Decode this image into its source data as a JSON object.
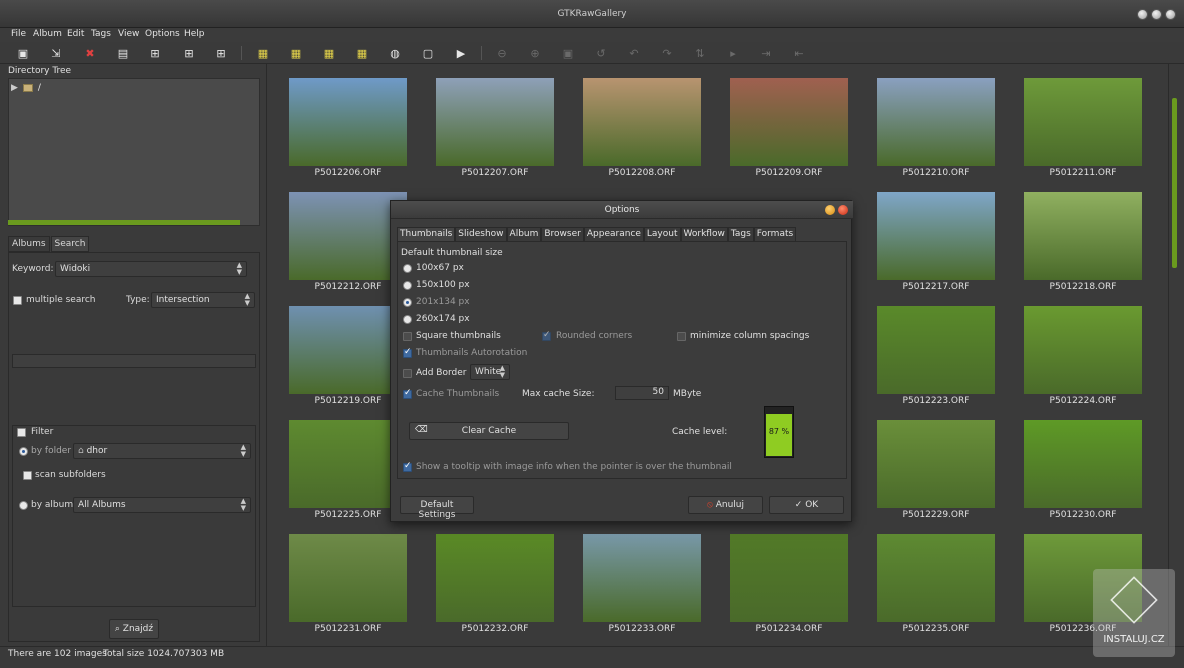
{
  "window": {
    "title": "GTKRawGallery"
  },
  "menu": [
    "File",
    "Album",
    "Edit",
    "Tags",
    "View",
    "Options",
    "Help"
  ],
  "left_panel": {
    "directory_tree_label": "Directory Tree",
    "tree_root": "/",
    "tabs": [
      "Albums",
      "Search"
    ],
    "keyword_label": "Keyword:",
    "keyword_value": "Widoki",
    "multiple_search_label": "multiple search",
    "type_label": "Type:",
    "type_value": "Intersection",
    "filter_label": "Filter",
    "by_folder_label": "by folder",
    "folder_value": "dhor",
    "scan_subfolders_label": "scan subfolders",
    "by_album_label": "by album",
    "album_value": "All Albums",
    "find_button": "Znajdź"
  },
  "status": {
    "images": "There are 102 images",
    "size": "Total size 1024.707303 MB"
  },
  "thumbnails": [
    {
      "name": "P5012206.ORF",
      "c": "#6f9ac8"
    },
    {
      "name": "P5012207.ORF",
      "c": "#8ea0b8"
    },
    {
      "name": "P5012208.ORF",
      "c": "#b89470"
    },
    {
      "name": "P5012209.ORF",
      "c": "#a06050"
    },
    {
      "name": "P5012210.ORF",
      "c": "#8aa0c0"
    },
    {
      "name": "P5012211.ORF",
      "c": "#6e9a3a"
    },
    {
      "name": "P5012212.ORF",
      "c": "#7d92b4"
    },
    {
      "name": "P5012217.ORF",
      "c": "#7fa6c8"
    },
    {
      "name": "P5012218.ORF",
      "c": "#90b060"
    },
    {
      "name": "P5012219.ORF",
      "c": "#6f90b0"
    },
    {
      "name": "P5012223.ORF",
      "c": "#5a8a2a"
    },
    {
      "name": "P5012224.ORF",
      "c": "#6a9a30"
    },
    {
      "name": "P5012225.ORF",
      "c": "#5e8a30"
    },
    {
      "name": "P5012229.ORF",
      "c": "#6a8f3a"
    },
    {
      "name": "P5012230.ORF",
      "c": "#5e9a26"
    },
    {
      "name": "P5012231.ORF",
      "c": "#6e8a48"
    },
    {
      "name": "P5012232.ORF",
      "c": "#5a8a26"
    },
    {
      "name": "P5012233.ORF",
      "c": "#7898a8"
    },
    {
      "name": "P5012234.ORF",
      "c": "#527a28"
    },
    {
      "name": "P5012235.ORF",
      "c": "#5e8a32"
    },
    {
      "name": "P5012236.ORF",
      "c": "#6e9a3a"
    }
  ],
  "dialog": {
    "title": "Options",
    "tabs": [
      "Thumbnails",
      "Slideshow",
      "Album",
      "Browser",
      "Appearance",
      "Layout",
      "Workflow",
      "Tags",
      "Formats"
    ],
    "default_size_label": "Default thumbnail size",
    "sizes": [
      "100x67 px",
      "150x100 px",
      "201x134 px",
      "260x174 px"
    ],
    "square_label": "Square thumbnails",
    "rounded_label": "Rounded corners",
    "minimize_label": "minimize column spacings",
    "autorotation_label": "Thumbnails Autorotation",
    "add_border_label": "Add Border",
    "border_color": "White",
    "cache_thumbs_label": "Cache Thumbnails",
    "max_cache_label": "Max cache Size:",
    "max_cache_value": "50",
    "max_cache_unit": "MByte",
    "clear_cache_label": "Clear Cache",
    "cache_level_label": "Cache level:",
    "cache_level_text": "87 %",
    "cache_level": 0.87,
    "tooltip_label": "Show a tooltip with image info when the pointer is over the thumbnail",
    "default_settings": "Default Settings",
    "cancel": "Anuluj",
    "ok": "OK"
  },
  "watermark": "INSTALUJ.CZ"
}
